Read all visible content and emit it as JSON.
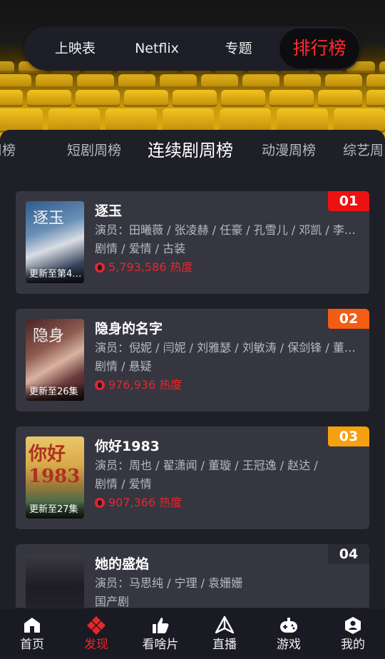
{
  "top_nav": {
    "tabs": [
      "上映表",
      "Netflix",
      "专题",
      "排行榜"
    ],
    "active_index": 3
  },
  "sub_tabs": {
    "items": [
      "影周榜",
      "短剧周榜",
      "连续剧周榜",
      "动漫周榜",
      "综艺周"
    ],
    "active_index": 2
  },
  "cards": [
    {
      "rank": "01",
      "rank_color": "#ee1111",
      "title": "逐玉",
      "cast": "演员：田曦薇 / 张凌赫 / 任豪 / 孔雪儿 / 邓凯 / 李…",
      "genre": "剧情 / 爱情 / 古装",
      "heat": "5,793,586 热度",
      "update": "更新至第4…",
      "poster_text": "逐玉"
    },
    {
      "rank": "02",
      "rank_color": "#f25c13",
      "title": "隐身的名字",
      "cast": "演员：倪妮 / 闫妮 / 刘雅瑟 / 刘敏涛 / 保剑锋 / 董…",
      "genre": "剧情 / 悬疑",
      "heat": "976,936 热度",
      "update": "更新至26集",
      "poster_text": "隐身"
    },
    {
      "rank": "03",
      "rank_color": "#f5a00f",
      "title": "你好1983",
      "cast": "演员：周也 / 翟潇闻 / 董璇 / 王冠逸 / 赵达 /",
      "genre": "剧情 / 爱情",
      "heat": "907,366 热度",
      "update": "更新至27集",
      "poster_text": "你好1983"
    },
    {
      "rank": "04",
      "rank_color": "#2b2c33",
      "title": "她的盛焰",
      "cast": "演员：马思纯 / 宁理 / 袁姗姗",
      "genre": "国产剧",
      "heat": "",
      "update": "",
      "poster_text": ""
    }
  ],
  "bottom_nav": {
    "items": [
      {
        "label": "首页",
        "icon": "home-icon"
      },
      {
        "label": "发现",
        "icon": "discover-icon"
      },
      {
        "label": "看啥片",
        "icon": "thumbs-up-icon"
      },
      {
        "label": "直播",
        "icon": "live-icon"
      },
      {
        "label": "游戏",
        "icon": "gamepad-icon"
      },
      {
        "label": "我的",
        "icon": "profile-icon"
      }
    ],
    "active_index": 1
  },
  "colors": {
    "accent": "#e8262c",
    "card_bg": "#353640",
    "page_bg": "#1e1f27"
  }
}
